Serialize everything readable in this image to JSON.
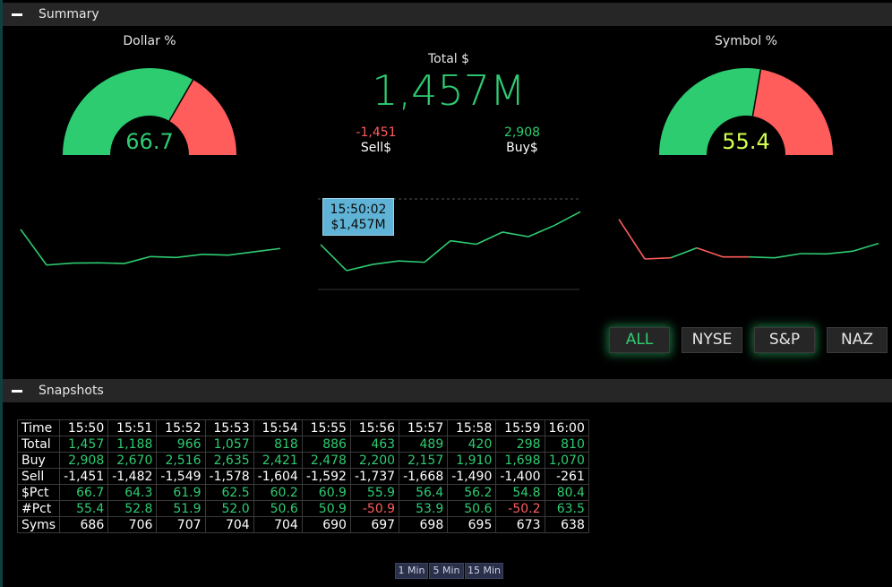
{
  "summary": {
    "header_label": "Summary",
    "dollar": {
      "title": "Dollar %",
      "value": "66.7",
      "value_color": "#2ecc71",
      "fill_pct": 66.7
    },
    "symbol": {
      "title": "Symbol %",
      "value": "55.4",
      "value_color": "#d4ff4f",
      "fill_pct": 55.4
    },
    "total": {
      "label": "Total $",
      "value": "1,457M",
      "sell_value": "-1,451",
      "sell_label": "Sell$",
      "buy_value": "2,908",
      "buy_label": "Buy$"
    },
    "tooltip": {
      "time": "15:50:02",
      "value": "$1,457M"
    },
    "market_buttons": [
      {
        "label": "ALL",
        "state": "active"
      },
      {
        "label": "NYSE",
        "state": "normal"
      },
      {
        "label": "S&P",
        "state": "active"
      },
      {
        "label": "NAZ",
        "state": "normal"
      }
    ]
  },
  "colors": {
    "green": "#2ecc71",
    "red": "#ff5c5c",
    "yellow": "#d4ff4f"
  },
  "sparklines": {
    "dollar_pct": [
      80.4,
      54.8,
      56.2,
      56.4,
      55.9,
      60.9,
      60.2,
      62.5,
      61.9,
      64.3,
      66.7
    ],
    "total": [
      810,
      298,
      420,
      489,
      463,
      886,
      818,
      1057,
      966,
      1188,
      1457
    ],
    "symbol_pct": [
      63.5,
      -50.2,
      50.6,
      53.9,
      -50.9,
      50.9,
      50.6,
      52.0,
      51.9,
      52.8,
      55.4
    ]
  },
  "snapshots": {
    "header_label": "Snapshots",
    "rows": [
      {
        "label": "Time",
        "color": "white",
        "cells": [
          "15:50",
          "15:51",
          "15:52",
          "15:53",
          "15:54",
          "15:55",
          "15:56",
          "15:57",
          "15:58",
          "15:59",
          "16:00"
        ]
      },
      {
        "label": "Total",
        "color": "green",
        "cells": [
          "1,457",
          "1,188",
          "966",
          "1,057",
          "818",
          "886",
          "463",
          "489",
          "420",
          "298",
          "810"
        ]
      },
      {
        "label": "Buy",
        "color": "green",
        "cells": [
          "2,908",
          "2,670",
          "2,516",
          "2,635",
          "2,421",
          "2,478",
          "2,200",
          "2,157",
          "1,910",
          "1,698",
          "1,070"
        ]
      },
      {
        "label": "Sell",
        "color": "white",
        "cells": [
          "-1,451",
          "-1,482",
          "-1,549",
          "-1,578",
          "-1,604",
          "-1,592",
          "-1,737",
          "-1,668",
          "-1,490",
          "-1,400",
          "-261"
        ]
      },
      {
        "label": "$Pct",
        "color": "green",
        "cells": [
          "66.7",
          "64.3",
          "61.9",
          "62.5",
          "60.2",
          "60.9",
          "55.9",
          "56.4",
          "56.2",
          "54.8",
          "80.4"
        ]
      },
      {
        "label": "#Pct",
        "color": "green",
        "cells": [
          "55.4",
          "52.8",
          "51.9",
          "52.0",
          "50.6",
          "50.9",
          "-50.9",
          "53.9",
          "50.6",
          "-50.2",
          "63.5"
        ]
      },
      {
        "label": "Syms",
        "color": "white",
        "cells": [
          "686",
          "706",
          "707",
          "704",
          "704",
          "690",
          "697",
          "698",
          "695",
          "673",
          "638"
        ]
      }
    ],
    "intervals": [
      "1 Min",
      "5 Min",
      "15 Min"
    ]
  }
}
